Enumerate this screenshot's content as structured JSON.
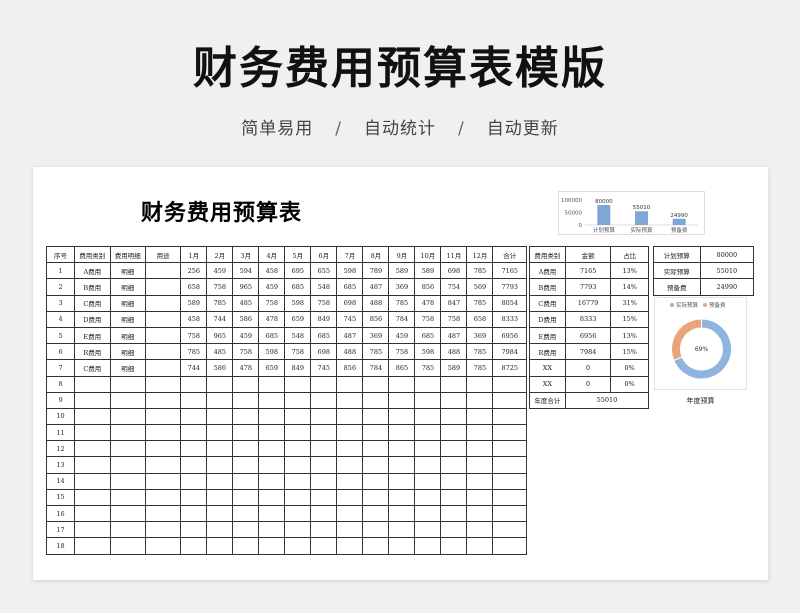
{
  "hero": {
    "title": "财务费用预算表模版",
    "tags": [
      "简单易用",
      "自动统计",
      "自动更新"
    ],
    "separator": "/"
  },
  "sheet": {
    "title": "财务费用预算表"
  },
  "main_table": {
    "headers": [
      "序号",
      "费用类别",
      "费用明细",
      "用途",
      "1月",
      "2月",
      "3月",
      "4月",
      "5月",
      "6月",
      "7月",
      "8月",
      "9月",
      "10月",
      "11月",
      "12月",
      "合计"
    ],
    "rows": [
      [
        "1",
        "A费用",
        "明细",
        "",
        "256",
        "459",
        "594",
        "458",
        "695",
        "655",
        "598",
        "789",
        "589",
        "589",
        "698",
        "785",
        "7165"
      ],
      [
        "2",
        "B费用",
        "明细",
        "",
        "658",
        "758",
        "965",
        "459",
        "685",
        "548",
        "685",
        "487",
        "369",
        "856",
        "754",
        "569",
        "7793"
      ],
      [
        "3",
        "C费用",
        "明细",
        "",
        "589",
        "785",
        "485",
        "758",
        "598",
        "758",
        "698",
        "488",
        "785",
        "478",
        "847",
        "785",
        "8054"
      ],
      [
        "4",
        "D费用",
        "明细",
        "",
        "458",
        "744",
        "586",
        "478",
        "659",
        "849",
        "745",
        "856",
        "784",
        "758",
        "758",
        "658",
        "8333"
      ],
      [
        "5",
        "E费用",
        "明细",
        "",
        "758",
        "965",
        "459",
        "685",
        "548",
        "685",
        "487",
        "369",
        "459",
        "685",
        "487",
        "369",
        "6956"
      ],
      [
        "6",
        "R费用",
        "明细",
        "",
        "785",
        "485",
        "758",
        "598",
        "758",
        "698",
        "488",
        "785",
        "758",
        "598",
        "488",
        "785",
        "7984"
      ],
      [
        "7",
        "C费用",
        "明细",
        "",
        "744",
        "586",
        "478",
        "659",
        "849",
        "745",
        "856",
        "784",
        "865",
        "785",
        "589",
        "785",
        "8725"
      ],
      [
        "8",
        "",
        "",
        "",
        "",
        "",
        "",
        "",
        "",
        "",
        "",
        "",
        "",
        "",
        "",
        "",
        ""
      ],
      [
        "9",
        "",
        "",
        "",
        "",
        "",
        "",
        "",
        "",
        "",
        "",
        "",
        "",
        "",
        "",
        "",
        ""
      ],
      [
        "10",
        "",
        "",
        "",
        "",
        "",
        "",
        "",
        "",
        "",
        "",
        "",
        "",
        "",
        "",
        "",
        ""
      ],
      [
        "11",
        "",
        "",
        "",
        "",
        "",
        "",
        "",
        "",
        "",
        "",
        "",
        "",
        "",
        "",
        "",
        ""
      ],
      [
        "12",
        "",
        "",
        "",
        "",
        "",
        "",
        "",
        "",
        "",
        "",
        "",
        "",
        "",
        "",
        "",
        ""
      ],
      [
        "13",
        "",
        "",
        "",
        "",
        "",
        "",
        "",
        "",
        "",
        "",
        "",
        "",
        "",
        "",
        "",
        ""
      ],
      [
        "14",
        "",
        "",
        "",
        "",
        "",
        "",
        "",
        "",
        "",
        "",
        "",
        "",
        "",
        "",
        "",
        ""
      ],
      [
        "15",
        "",
        "",
        "",
        "",
        "",
        "",
        "",
        "",
        "",
        "",
        "",
        "",
        "",
        "",
        "",
        ""
      ],
      [
        "16",
        "",
        "",
        "",
        "",
        "",
        "",
        "",
        "",
        "",
        "",
        "",
        "",
        "",
        "",
        "",
        ""
      ],
      [
        "17",
        "",
        "",
        "",
        "",
        "",
        "",
        "",
        "",
        "",
        "",
        "",
        "",
        "",
        "",
        "",
        ""
      ],
      [
        "18",
        "",
        "",
        "",
        "",
        "",
        "",
        "",
        "",
        "",
        "",
        "",
        "",
        "",
        "",
        "",
        ""
      ]
    ]
  },
  "summary_table": {
    "headers": [
      "费用类别",
      "金额",
      "占比"
    ],
    "rows": [
      [
        "A费用",
        "7165",
        "13%"
      ],
      [
        "B费用",
        "7793",
        "14%"
      ],
      [
        "C费用",
        "16779",
        "31%"
      ],
      [
        "D费用",
        "8333",
        "15%"
      ],
      [
        "E费用",
        "6956",
        "13%"
      ],
      [
        "R费用",
        "7984",
        "15%"
      ],
      [
        "XX",
        "0",
        "0%"
      ],
      [
        "XX",
        "0",
        "0%"
      ]
    ],
    "total_label": "年度合计",
    "total_value": "55010"
  },
  "budget_table": {
    "rows": [
      [
        "计划预算",
        "80000"
      ],
      [
        "实际预算",
        "55010"
      ],
      [
        "预备费",
        "24990"
      ]
    ]
  },
  "chart_data": [
    {
      "type": "bar",
      "categories": [
        "计划预算",
        "实际预算",
        "预备费"
      ],
      "values": [
        80000,
        55010,
        24990
      ],
      "data_labels": [
        "80000",
        "55010",
        "24990"
      ],
      "y_ticks": [
        "100000",
        "50000",
        "0"
      ],
      "ylim": [
        0,
        100000
      ],
      "color": "#7fa7d6"
    },
    {
      "type": "pie",
      "categories": [
        "实际预算",
        "预备费"
      ],
      "values": [
        55010,
        24990
      ],
      "center_label": "69%",
      "colors": [
        "#8fb4de",
        "#e8a57a"
      ],
      "legend": "top",
      "caption": "年度预算"
    }
  ]
}
